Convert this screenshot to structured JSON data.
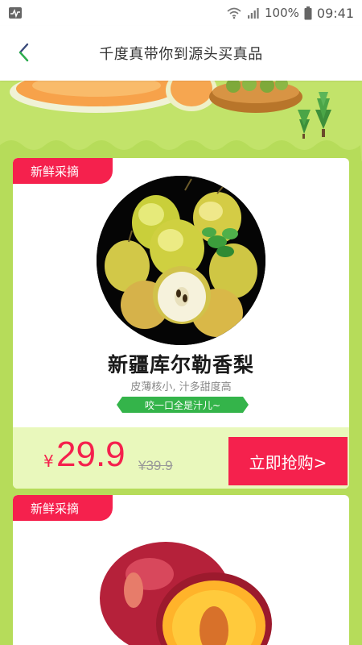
{
  "status_bar": {
    "battery": "100%",
    "time": "09:41"
  },
  "nav": {
    "title": "千度真带你到源头买真品"
  },
  "products": [
    {
      "tag": "新鲜采摘",
      "name": "新疆库尔勒香梨",
      "desc": "皮薄核小, 汁多甜度高",
      "slogan": "咬一口全是汁儿~",
      "price_symbol": "¥",
      "price": "29.9",
      "original_price": "¥39.9",
      "buy_label": "立即抢购>"
    },
    {
      "tag": "新鲜采摘"
    }
  ],
  "colors": {
    "accent_red": "#f5214d",
    "green_bg": "#b6dc5a",
    "price_bg": "#e9f8bc",
    "slogan_green": "#34b44a"
  },
  "icons": [
    "activity-icon",
    "back-arrow-icon",
    "wifi-icon",
    "signal-icon",
    "battery-icon"
  ]
}
